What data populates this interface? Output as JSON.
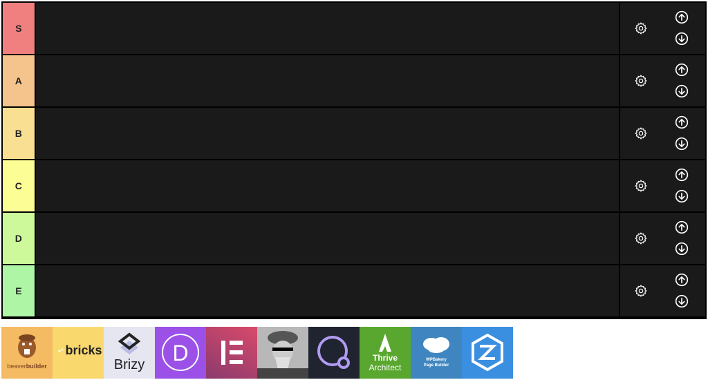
{
  "tiers": [
    {
      "label": "S",
      "color": "#f07f7f"
    },
    {
      "label": "A",
      "color": "#f5c38c"
    },
    {
      "label": "B",
      "color": "#f9df91"
    },
    {
      "label": "C",
      "color": "#fdfd96"
    },
    {
      "label": "D",
      "color": "#cdf99a"
    },
    {
      "label": "E",
      "color": "#aef5a6"
    }
  ],
  "tier_controls": {
    "settings_icon": "gear-icon",
    "move_up_icon": "arrow-up-circle-icon",
    "move_down_icon": "arrow-down-circle-icon"
  },
  "unranked_items": [
    {
      "name": "Beaver Builder",
      "caption_a": "beaver",
      "caption_b": "builder",
      "bg": "#f5bb62"
    },
    {
      "name": "Bricks",
      "caption": "bricks",
      "bg": "#f9d96e"
    },
    {
      "name": "Brizy",
      "caption": "Brizy",
      "bg": "#e5e6f0"
    },
    {
      "name": "Divi",
      "caption": "D",
      "bg": "#9b51e8"
    },
    {
      "name": "Elementor",
      "bg": "#c2455f"
    },
    {
      "name": "Gutenberg",
      "bg": "#8a8a8a"
    },
    {
      "name": "Oxygen",
      "bg": "#1f2430"
    },
    {
      "name": "Thrive Architect",
      "caption_a": "Thrive",
      "caption_b": "Architect",
      "bg": "#5aa72f"
    },
    {
      "name": "WPBakery Page Builder",
      "caption_a": "WPBakery",
      "caption_b": "Page Builder",
      "bg": "#3f86c0"
    },
    {
      "name": "Zion Builder",
      "bg": "#3b8fe0"
    }
  ]
}
